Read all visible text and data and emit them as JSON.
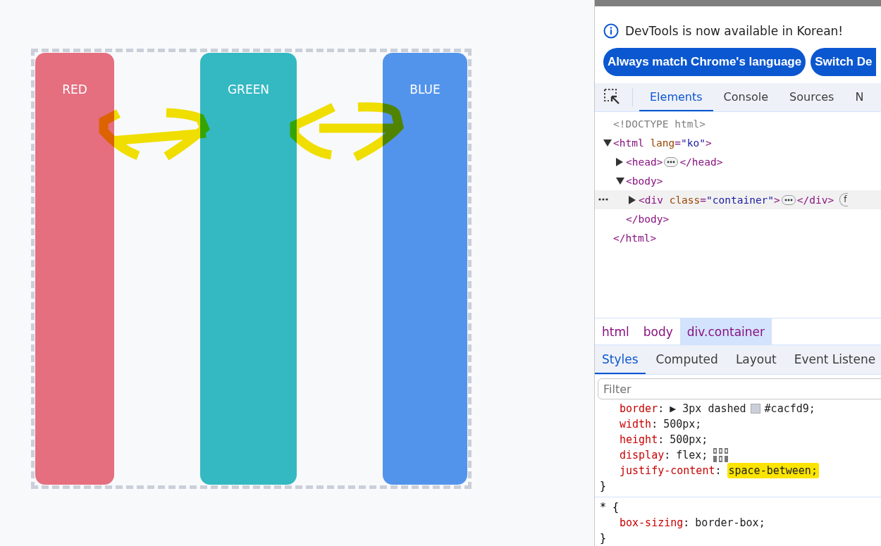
{
  "page": {
    "columns": [
      {
        "label": "RED",
        "color": "#e56e7f"
      },
      {
        "label": "GREEN",
        "color": "#34b8c2"
      },
      {
        "label": "BLUE",
        "color": "#5294ec"
      }
    ],
    "annotations": [
      {
        "kind": "double_arrow"
      },
      {
        "kind": "double_arrow"
      }
    ]
  },
  "devtools": {
    "infobar": {
      "message": "DevTools is now available in Korean!",
      "buttons": [
        "Always match Chrome's language",
        "Switch De"
      ]
    },
    "tabs": [
      {
        "label": "Elements",
        "selected": true
      },
      {
        "label": "Console",
        "selected": false
      },
      {
        "label": "Sources",
        "selected": false
      },
      {
        "label": "N",
        "selected": false
      }
    ],
    "dom_tree": [
      {
        "kind": "doctype",
        "parts": [
          {
            "t": "<!DOCTYPE html>",
            "kind": "doctype"
          }
        ]
      },
      {
        "kind": "element",
        "expanded": true,
        "selected": false,
        "parts": [
          {
            "t": "<html",
            "kind": "tag"
          },
          {
            "t": " lang",
            "kind": "attr"
          },
          {
            "t": "=",
            "kind": "tag"
          },
          {
            "t": "\"ko\"",
            "kind": "value"
          },
          {
            "t": ">",
            "kind": "tag"
          }
        ],
        "close": [
          {
            "t": "</html>",
            "kind": "tag"
          }
        ],
        "children": [
          {
            "kind": "element",
            "expanded": false,
            "selected": false,
            "parts": [
              {
                "t": "<head>",
                "kind": "tag"
              }
            ],
            "close": [
              {
                "t": "</head>",
                "kind": "tag"
              }
            ]
          },
          {
            "kind": "element",
            "expanded": true,
            "selected": false,
            "parts": [
              {
                "t": "<body>",
                "kind": "tag"
              }
            ],
            "close": [
              {
                "t": "</body>",
                "kind": "tag"
              }
            ],
            "children": [
              {
                "kind": "element",
                "expanded": false,
                "selected": true,
                "parts": [
                  {
                    "t": "<div",
                    "kind": "tag"
                  },
                  {
                    "t": " class",
                    "kind": "attr"
                  },
                  {
                    "t": "=",
                    "kind": "tag"
                  },
                  {
                    "t": "\"container\"",
                    "kind": "value"
                  },
                  {
                    "t": ">",
                    "kind": "tag"
                  }
                ],
                "close": [
                  {
                    "t": "</div>",
                    "kind": "tag"
                  }
                ],
                "badge": "f"
              }
            ]
          }
        ]
      }
    ],
    "breadcrumbs": [
      {
        "label": "html",
        "selected": false
      },
      {
        "label": "body",
        "selected": false
      },
      {
        "label": "div.container",
        "selected": true
      }
    ],
    "pane_tabs": [
      {
        "label": "Styles",
        "selected": true
      },
      {
        "label": "Computed",
        "selected": false
      },
      {
        "label": "Layout",
        "selected": false
      },
      {
        "label": "Event Listene",
        "selected": false
      }
    ],
    "filter": {
      "placeholder": "Filter"
    },
    "rules": [
      {
        "declarations": [
          {
            "name": "border",
            "punct": ":",
            "value": "▶ 3px dashed",
            "color": "#cacfd9",
            "value2": "#cacfd9;"
          },
          {
            "name": "width",
            "punct": ":",
            "value": "500px;"
          },
          {
            "name": "height",
            "punct": ":",
            "value": "500px;"
          },
          {
            "name": "display",
            "punct": ":",
            "value": "flex;",
            "flex_editor": true
          },
          {
            "name": "justify-content",
            "punct": ":",
            "value": "space-between;",
            "highlighted": true
          }
        ],
        "close": "}"
      },
      {
        "selector": "* {",
        "declarations": [
          {
            "name": "box-sizing",
            "punct": ":",
            "value": "border-box;"
          }
        ],
        "close": "}"
      }
    ]
  }
}
